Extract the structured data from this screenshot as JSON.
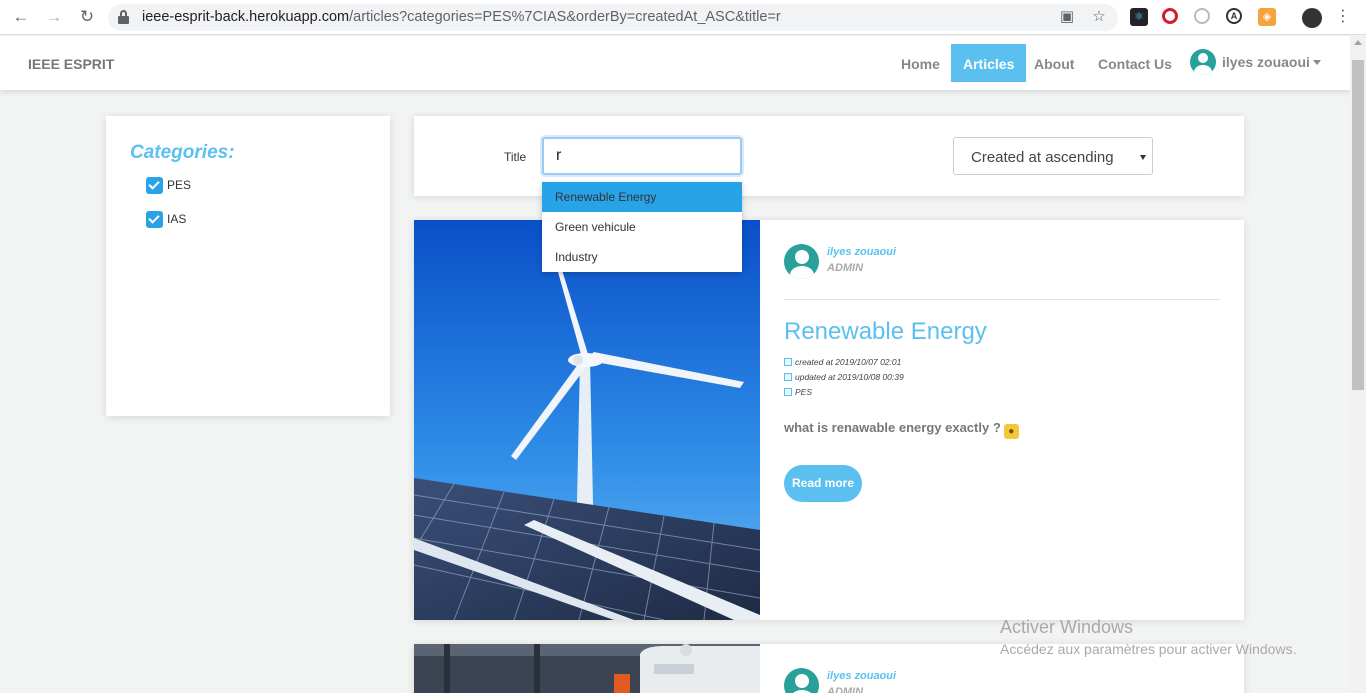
{
  "browser": {
    "url_host": "ieee-esprit-back.herokuapp.com",
    "url_rest": "/articles?categories=PES%7CIAS&orderBy=createdAt_ASC&title=r"
  },
  "navbar": {
    "brand": "IEEE ESPRIT",
    "links": [
      "Home",
      "Articles",
      "About",
      "Contact Us"
    ],
    "active_link": "Articles",
    "user_name": "ilyes zouaoui"
  },
  "categories": {
    "title": "Categories:",
    "items": [
      {
        "label": "PES",
        "checked": true
      },
      {
        "label": "IAS",
        "checked": true
      }
    ]
  },
  "filter": {
    "title_label": "Title",
    "title_value": "r",
    "sort_value": "Created at ascending"
  },
  "autocomplete": {
    "items": [
      "Renewable Energy",
      "Green vehicule",
      "Industry"
    ],
    "highlighted": "Renewable Energy"
  },
  "articles": [
    {
      "author": "ilyes zouaoui",
      "role": "ADMIN",
      "title": "Renewable Energy",
      "created": "created at 2019/10/07 02:01",
      "updated": "updated at 2019/10/08 00:39",
      "category": "PES",
      "summary": "what is renawable energy exactly ?",
      "read_more": "Read more"
    },
    {
      "author": "ilyes zouaoui",
      "role": "ADMIN"
    }
  ],
  "watermark": {
    "title": "Activer Windows",
    "subtitle": "Accédez aux paramètres pour activer Windows."
  },
  "colors": {
    "accent": "#5bc0f0",
    "checkbox": "#29a3e8",
    "avatar": "#27a19a"
  }
}
